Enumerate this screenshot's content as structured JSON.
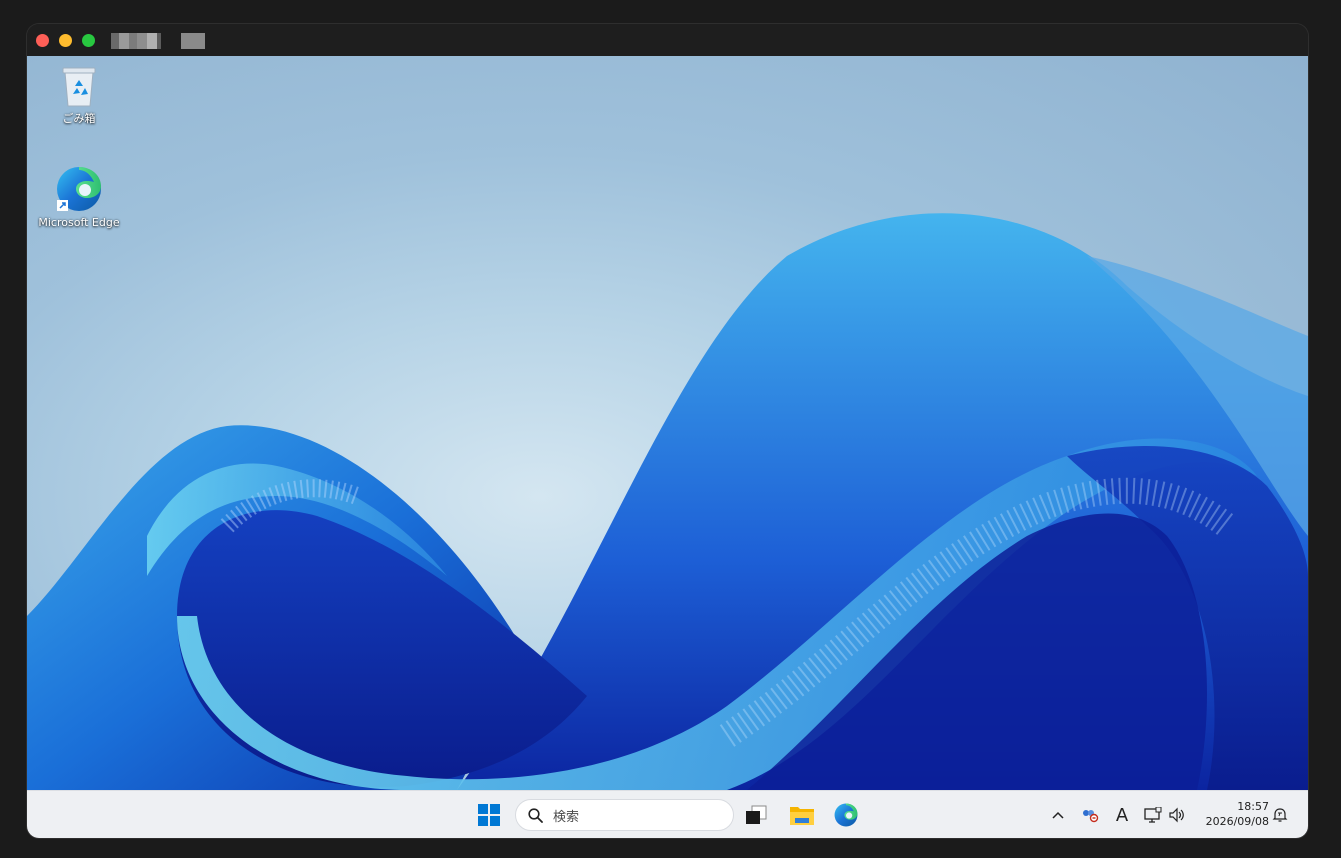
{
  "desktop": {
    "icons": [
      {
        "name": "recycle-bin",
        "label": "ごみ箱"
      },
      {
        "name": "edge-shortcut",
        "label": "Microsoft Edge"
      }
    ]
  },
  "taskbar": {
    "search_placeholder": "検索",
    "apps": [
      "start-icon",
      "search-icon",
      "task-view-icon",
      "file-explorer-icon",
      "edge-icon"
    ],
    "tray": {
      "ime_label": "A",
      "time": "18:57",
      "date": "2026/09/08"
    }
  },
  "colors": {
    "close": "#fe5f57",
    "minimize": "#febc2e",
    "maximize": "#28c840",
    "taskbar_bg": "#eef0f3",
    "windows_blue": "#0078d4"
  }
}
